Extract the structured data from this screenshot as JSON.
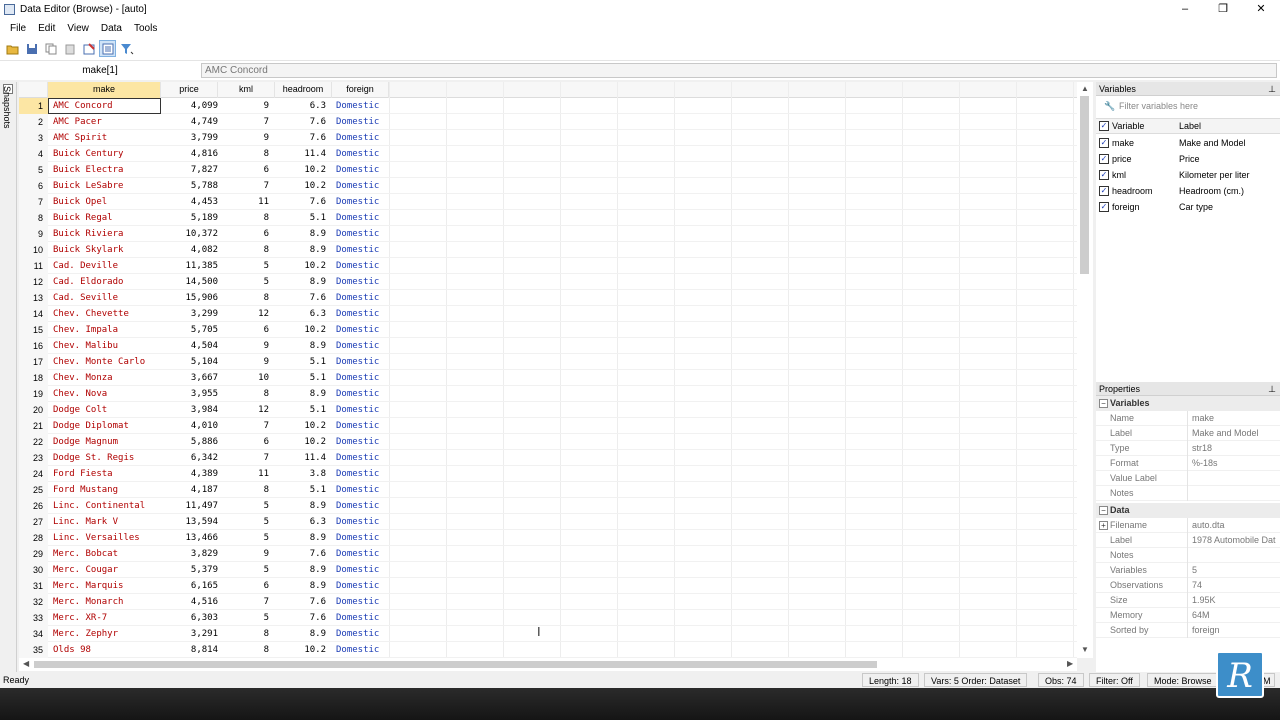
{
  "window": {
    "title": "Data Editor (Browse) - [auto]",
    "minimize": "–",
    "maximize": "❐",
    "close": "✕"
  },
  "menu": [
    "File",
    "Edit",
    "View",
    "Data",
    "Tools"
  ],
  "cellbar": {
    "name": "make[1]",
    "value": "AMC Concord"
  },
  "snapshots_label": "Snapshots",
  "grid": {
    "columns": [
      "make",
      "price",
      "kml",
      "headroom",
      "foreign"
    ],
    "selected_row": 1,
    "selected_column": "make",
    "rows": [
      [
        "1",
        "AMC Concord",
        "4,099",
        "9",
        "6.3",
        "Domestic"
      ],
      [
        "2",
        "AMC Pacer",
        "4,749",
        "7",
        "7.6",
        "Domestic"
      ],
      [
        "3",
        "AMC Spirit",
        "3,799",
        "9",
        "7.6",
        "Domestic"
      ],
      [
        "4",
        "Buick Century",
        "4,816",
        "8",
        "11.4",
        "Domestic"
      ],
      [
        "5",
        "Buick Electra",
        "7,827",
        "6",
        "10.2",
        "Domestic"
      ],
      [
        "6",
        "Buick LeSabre",
        "5,788",
        "7",
        "10.2",
        "Domestic"
      ],
      [
        "7",
        "Buick Opel",
        "4,453",
        "11",
        "7.6",
        "Domestic"
      ],
      [
        "8",
        "Buick Regal",
        "5,189",
        "8",
        "5.1",
        "Domestic"
      ],
      [
        "9",
        "Buick Riviera",
        "10,372",
        "6",
        "8.9",
        "Domestic"
      ],
      [
        "10",
        "Buick Skylark",
        "4,082",
        "8",
        "8.9",
        "Domestic"
      ],
      [
        "11",
        "Cad. Deville",
        "11,385",
        "5",
        "10.2",
        "Domestic"
      ],
      [
        "12",
        "Cad. Eldorado",
        "14,500",
        "5",
        "8.9",
        "Domestic"
      ],
      [
        "13",
        "Cad. Seville",
        "15,906",
        "8",
        "7.6",
        "Domestic"
      ],
      [
        "14",
        "Chev. Chevette",
        "3,299",
        "12",
        "6.3",
        "Domestic"
      ],
      [
        "15",
        "Chev. Impala",
        "5,705",
        "6",
        "10.2",
        "Domestic"
      ],
      [
        "16",
        "Chev. Malibu",
        "4,504",
        "9",
        "8.9",
        "Domestic"
      ],
      [
        "17",
        "Chev. Monte Carlo",
        "5,104",
        "9",
        "5.1",
        "Domestic"
      ],
      [
        "18",
        "Chev. Monza",
        "3,667",
        "10",
        "5.1",
        "Domestic"
      ],
      [
        "19",
        "Chev. Nova",
        "3,955",
        "8",
        "8.9",
        "Domestic"
      ],
      [
        "20",
        "Dodge Colt",
        "3,984",
        "12",
        "5.1",
        "Domestic"
      ],
      [
        "21",
        "Dodge Diplomat",
        "4,010",
        "7",
        "10.2",
        "Domestic"
      ],
      [
        "22",
        "Dodge Magnum",
        "5,886",
        "6",
        "10.2",
        "Domestic"
      ],
      [
        "23",
        "Dodge St. Regis",
        "6,342",
        "7",
        "11.4",
        "Domestic"
      ],
      [
        "24",
        "Ford Fiesta",
        "4,389",
        "11",
        "3.8",
        "Domestic"
      ],
      [
        "25",
        "Ford Mustang",
        "4,187",
        "8",
        "5.1",
        "Domestic"
      ],
      [
        "26",
        "Linc. Continental",
        "11,497",
        "5",
        "8.9",
        "Domestic"
      ],
      [
        "27",
        "Linc. Mark V",
        "13,594",
        "5",
        "6.3",
        "Domestic"
      ],
      [
        "28",
        "Linc. Versailles",
        "13,466",
        "5",
        "8.9",
        "Domestic"
      ],
      [
        "29",
        "Merc. Bobcat",
        "3,829",
        "9",
        "7.6",
        "Domestic"
      ],
      [
        "30",
        "Merc. Cougar",
        "5,379",
        "5",
        "8.9",
        "Domestic"
      ],
      [
        "31",
        "Merc. Marquis",
        "6,165",
        "6",
        "8.9",
        "Domestic"
      ],
      [
        "32",
        "Merc. Monarch",
        "4,516",
        "7",
        "7.6",
        "Domestic"
      ],
      [
        "33",
        "Merc. XR-7",
        "6,303",
        "5",
        "7.6",
        "Domestic"
      ],
      [
        "34",
        "Merc. Zephyr",
        "3,291",
        "8",
        "8.9",
        "Domestic"
      ],
      [
        "35",
        "Olds 98",
        "8,814",
        "8",
        "10.2",
        "Domestic"
      ]
    ]
  },
  "variables_pane": {
    "title": "Variables",
    "filter_placeholder": "Filter variables here",
    "header": {
      "variable": "Variable",
      "label": "Label"
    },
    "items": [
      {
        "name": "make",
        "label": "Make and Model"
      },
      {
        "name": "price",
        "label": "Price"
      },
      {
        "name": "kml",
        "label": "Kilometer per liter"
      },
      {
        "name": "headroom",
        "label": "Headroom (cm.)"
      },
      {
        "name": "foreign",
        "label": "Car type"
      }
    ]
  },
  "properties_pane": {
    "title": "Properties",
    "variables_group": "Variables",
    "variables_props": [
      {
        "key": "Name",
        "value": "make"
      },
      {
        "key": "Label",
        "value": "Make and Model"
      },
      {
        "key": "Type",
        "value": "str18"
      },
      {
        "key": "Format",
        "value": "%-18s"
      },
      {
        "key": "Value Label",
        "value": ""
      },
      {
        "key": "Notes",
        "value": ""
      }
    ],
    "data_group": "Data",
    "data_props": [
      {
        "key": "Filename",
        "value": "auto.dta"
      },
      {
        "key": "Label",
        "value": "1978 Automobile Dat"
      },
      {
        "key": "Notes",
        "value": ""
      },
      {
        "key": "Variables",
        "value": "5"
      },
      {
        "key": "Observations",
        "value": "74"
      },
      {
        "key": "Size",
        "value": "1.95K"
      },
      {
        "key": "Memory",
        "value": "64M"
      },
      {
        "key": "Sorted by",
        "value": "foreign"
      }
    ]
  },
  "status": {
    "ready": "Ready",
    "length": "Length: 18",
    "vars": "Vars: 5  Order: Dataset",
    "obs": "Obs: 74",
    "filter": "Filter: Off",
    "mode": "Mode: Browse",
    "num": "NUM"
  },
  "logo_letter": "R"
}
